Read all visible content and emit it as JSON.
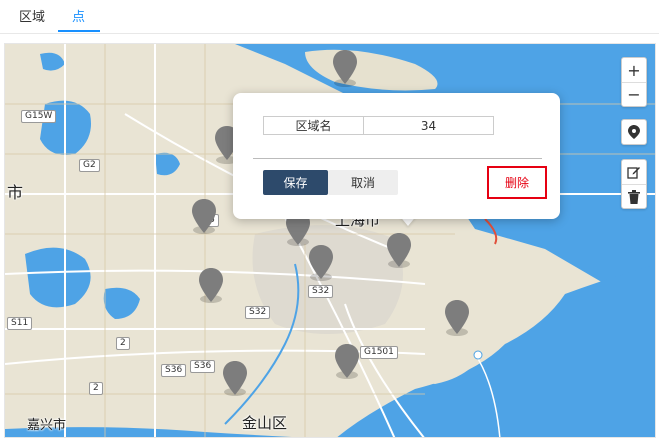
{
  "tabs": [
    {
      "label": "区域"
    },
    {
      "label": "点"
    }
  ],
  "map": {
    "places": [
      "上海市",
      "嘉兴市",
      "金山区",
      "市"
    ],
    "roads": [
      "G15W",
      "G2",
      "S11",
      "S32",
      "S32",
      "S36",
      "S36",
      "G1501",
      "2",
      "2",
      "6"
    ],
    "controls": {
      "zoom_in": "+",
      "zoom_out": "−"
    }
  },
  "popup": {
    "attr_name": "区域名",
    "attr_value": "34",
    "save_label": "保存",
    "cancel_label": "取消",
    "delete_label": "删除"
  },
  "colors": {
    "water": "#4ea3e6",
    "land": "#e9e4d4",
    "accent": "#1890ff",
    "save_button": "#2d4a6b",
    "delete_highlight": "#e60012",
    "pin": "#7d7d7d"
  }
}
